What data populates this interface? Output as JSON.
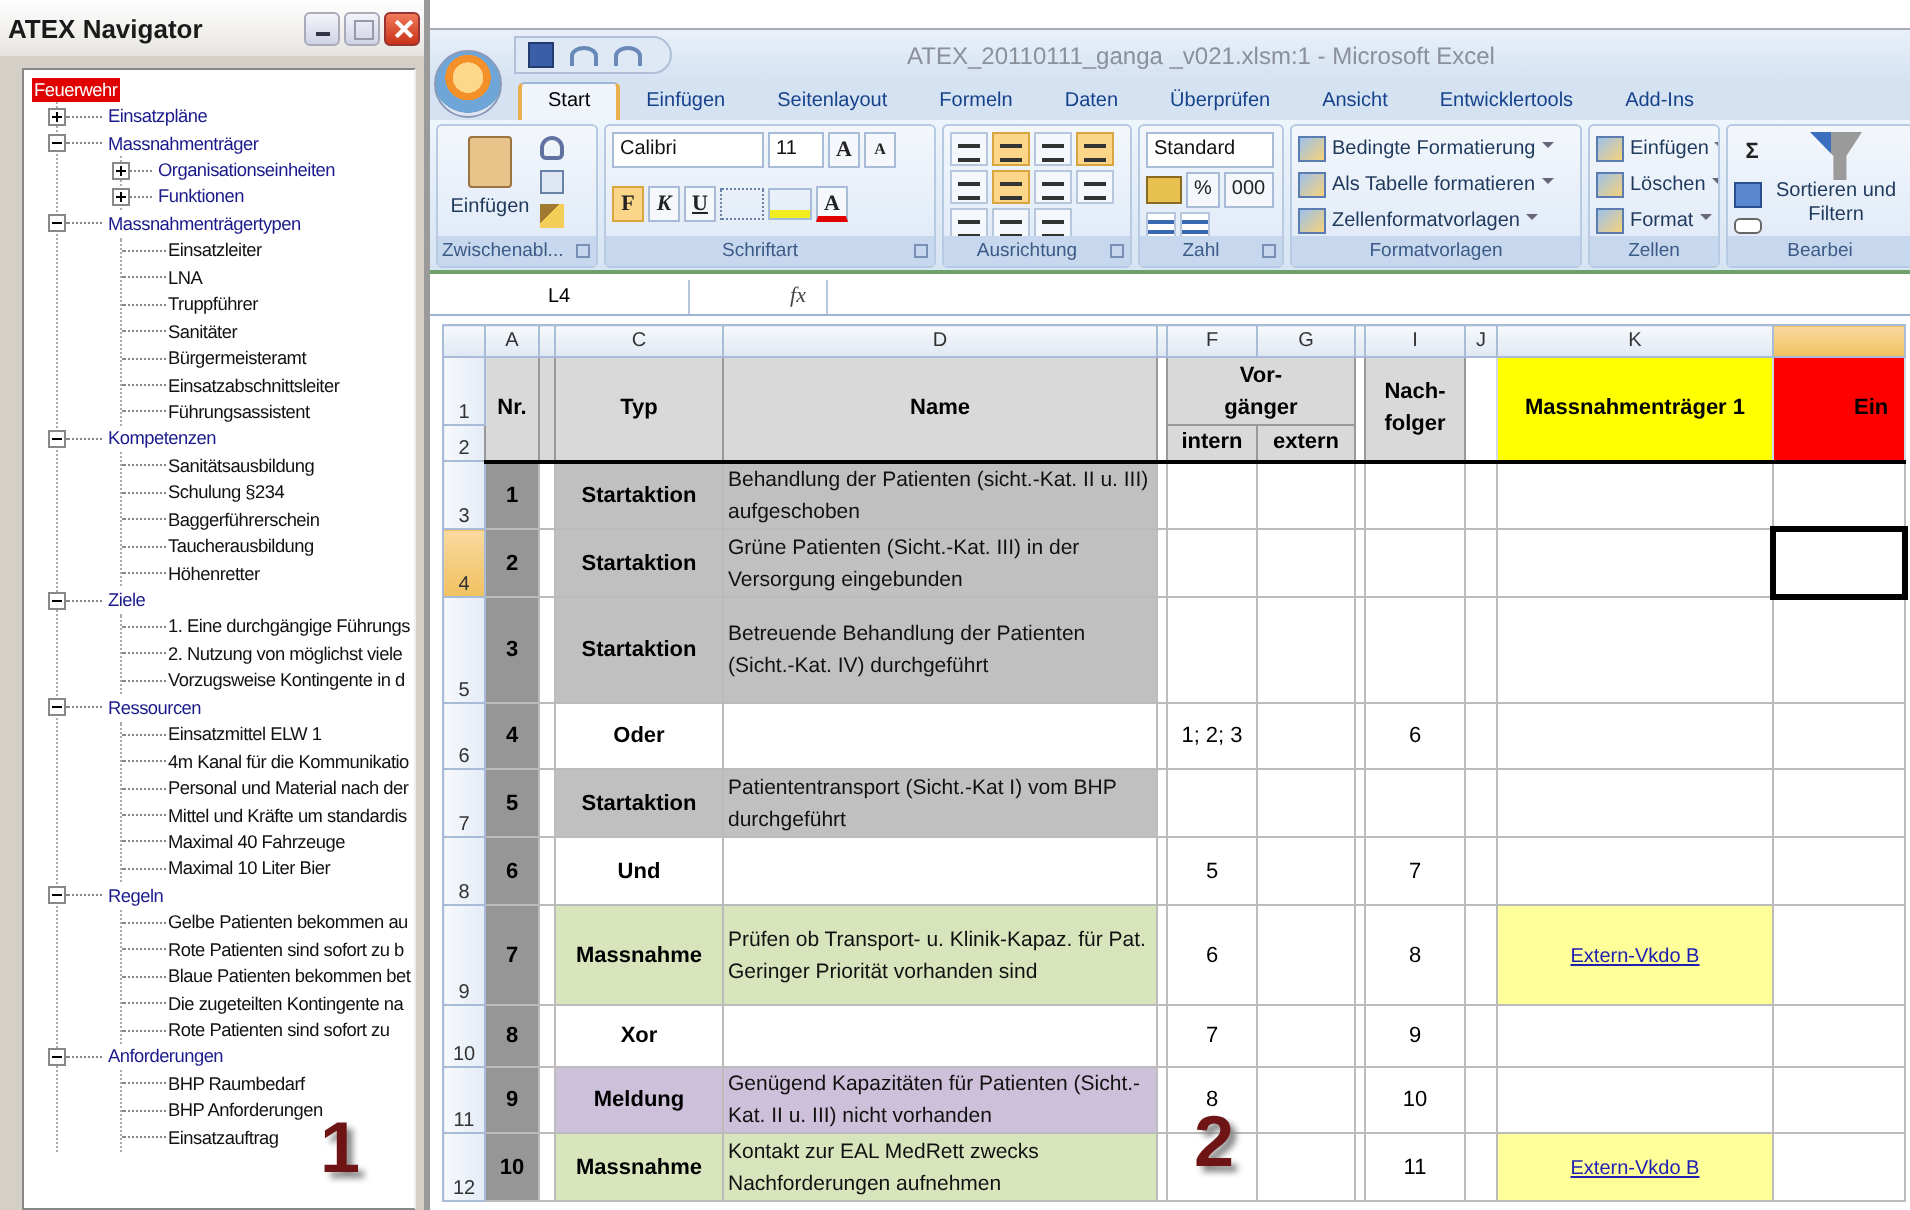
{
  "navigator": {
    "title": "ATEX Navigator",
    "tree": {
      "label": "Feuerwehr",
      "selected": true,
      "children": [
        {
          "label": "Einsatzpläne",
          "expanded": false,
          "selected": false
        },
        {
          "label": "Massnahmenträger",
          "expanded": true,
          "selected": false,
          "children": [
            {
              "label": "Organisationseinheiten",
              "expanded": false,
              "selected": false
            },
            {
              "label": "Funktionen",
              "expanded": false,
              "selected": false
            }
          ]
        },
        {
          "label": "Massnahmenträgertypen",
          "expanded": true,
          "selected": false,
          "children": [
            {
              "label": "Einsatzleiter",
              "selected": false
            },
            {
              "label": "LNA",
              "selected": false
            },
            {
              "label": "Truppführer",
              "selected": false
            },
            {
              "label": "Sanitäter",
              "selected": false
            },
            {
              "label": "Bürgermeisteramt",
              "selected": false
            },
            {
              "label": "Einsatzabschnittsleiter",
              "selected": false
            },
            {
              "label": "Führungsassistent",
              "selected": false
            }
          ]
        },
        {
          "label": "Kompetenzen",
          "expanded": true,
          "selected": false,
          "children": [
            {
              "label": "Sanitätsausbildung",
              "selected": false
            },
            {
              "label": "Schulung §234",
              "selected": false
            },
            {
              "label": "Baggerführerschein",
              "selected": false
            },
            {
              "label": "Taucherausbildung",
              "selected": false
            },
            {
              "label": "Höhenretter",
              "selected": false
            }
          ]
        },
        {
          "label": "Ziele",
          "expanded": true,
          "selected": false,
          "children": [
            {
              "label": "1. Eine durchgängige Führungs",
              "selected": false
            },
            {
              "label": "2. Nutzung von möglichst viele",
              "selected": false
            },
            {
              "label": "Vorzugsweise Kontingente in d",
              "selected": false
            }
          ]
        },
        {
          "label": "Ressourcen",
          "expanded": true,
          "selected": false,
          "children": [
            {
              "label": "Einsatzmittel ELW 1",
              "selected": false
            },
            {
              "label": "4m Kanal für die Kommunikatio",
              "selected": false
            },
            {
              "label": "Personal und Material nach der",
              "selected": false
            },
            {
              "label": "Mittel und Kräfte um standardis",
              "selected": false
            },
            {
              "label": "Maximal 40 Fahrzeuge",
              "selected": false
            },
            {
              "label": "Maximal 10 Liter Bier",
              "selected": false
            }
          ]
        },
        {
          "label": "Regeln",
          "expanded": true,
          "selected": false,
          "children": [
            {
              "label": "Gelbe Patienten bekommen au",
              "selected": false
            },
            {
              "label": "Rote Patienten sind sofort zu b",
              "selected": false
            },
            {
              "label": "Blaue Patienten bekommen bet",
              "selected": false
            },
            {
              "label": "Die zugeteilten Kontingente na",
              "selected": false
            },
            {
              "label": "Rote Patienten sind sofort zu",
              "selected": false
            }
          ]
        },
        {
          "label": "Anforderungen",
          "expanded": true,
          "selected": false,
          "children": [
            {
              "label": "BHP Raumbedarf",
              "selected": false
            },
            {
              "label": "BHP Anforderungen",
              "selected": false
            },
            {
              "label": "Einsatzauftrag",
              "selected": false
            }
          ]
        }
      ]
    }
  },
  "excel": {
    "title": "ATEX_20110111_ganga _v021.xlsm:1 - Microsoft Excel",
    "tabs": [
      {
        "label": "Start",
        "selected": true
      },
      {
        "label": "Einfügen",
        "selected": false
      },
      {
        "label": "Seitenlayout",
        "selected": false
      },
      {
        "label": "Formeln",
        "selected": false
      },
      {
        "label": "Daten",
        "selected": false
      },
      {
        "label": "Überprüfen",
        "selected": false
      },
      {
        "label": "Ansicht",
        "selected": false
      },
      {
        "label": "Entwicklertools",
        "selected": false
      },
      {
        "label": "Add-Ins",
        "selected": false
      }
    ],
    "ribbon": [
      {
        "kind": "clipboard",
        "label": "Zwischenabl...",
        "paste": "Einfügen"
      },
      {
        "kind": "font",
        "label": "Schriftart",
        "font": "Calibri",
        "size": "11",
        "grow": "A",
        "shrink": "A",
        "styles": [
          {
            "label": "F",
            "on": true
          },
          {
            "label": "K",
            "on": false
          },
          {
            "label": "U",
            "on": false
          }
        ],
        "font_color": "A"
      },
      {
        "kind": "alignment",
        "label": "Ausrichtung",
        "buttons": [
          {
            "on": false
          },
          {
            "on": true
          },
          {
            "on": false
          },
          {
            "on": true
          },
          {
            "on": false
          },
          {
            "on": true
          },
          {
            "on": false
          },
          {
            "on": false
          }
        ]
      },
      {
        "kind": "number",
        "label": "Zahl",
        "format": "Standard",
        "percent": "%",
        "thousands": "000"
      },
      {
        "kind": "styles",
        "label": "Formatvorlagen",
        "items": [
          "Bedingte Formatierung",
          "Als Tabelle formatieren",
          "Zellenformatvorlagen"
        ]
      },
      {
        "kind": "cells",
        "label": "Zellen",
        "items": [
          "Einfügen",
          "Löschen",
          "Format"
        ]
      },
      {
        "kind": "editing",
        "label": "Bearbei",
        "sum": "Σ",
        "sort": "Sortieren und Filtern"
      }
    ],
    "name_box": "L4",
    "function_button": "fx",
    "sheet": {
      "column_headers": [
        {
          "label": "A",
          "selected": false
        },
        {
          "selected": false
        },
        {
          "label": "C",
          "selected": false
        },
        {
          "label": "D",
          "selected": false
        },
        {
          "selected": false
        },
        {
          "label": "F",
          "selected": false
        },
        {
          "label": "G",
          "selected": false
        },
        {
          "selected": false
        },
        {
          "label": "I",
          "selected": false
        },
        {
          "label": "J",
          "selected": false
        },
        {
          "label": "K",
          "selected": false
        },
        {
          "selected": true
        }
      ],
      "row_numbers": [
        {
          "label": "1",
          "selected": false
        },
        {
          "label": "2",
          "selected": false
        },
        {
          "label": "3",
          "selected": false
        },
        {
          "label": "4",
          "selected": true
        },
        {
          "label": "5",
          "selected": false
        },
        {
          "label": "6",
          "selected": false
        },
        {
          "label": "7",
          "selected": false
        },
        {
          "label": "8",
          "selected": false
        },
        {
          "label": "9",
          "selected": false
        },
        {
          "label": "10",
          "selected": false
        },
        {
          "label": "11",
          "selected": false
        },
        {
          "label": "12",
          "selected": false
        }
      ],
      "header": {
        "nr": "Nr.",
        "typ": "Typ",
        "name": "Name",
        "predecessor": "Vor-gänger",
        "intern": "intern",
        "extern": "extern",
        "successor": "Nach-folger",
        "k": "Massnahmenträger 1",
        "l": "Ein"
      },
      "rows": [
        {
          "kind": "startaktion",
          "nr": "1",
          "typ": "Startaktion",
          "name": "Behandlung der Patienten (sicht.-Kat. II u. III) aufgeschoben",
          "cursor": false
        },
        {
          "kind": "startaktion",
          "nr": "2",
          "typ": "Startaktion",
          "name": "Grüne Patienten (Sicht.-Kat. III) in der Versorgung eingebunden",
          "cursor": true
        },
        {
          "kind": "startaktion",
          "nr": "3",
          "typ": "Startaktion",
          "name": "Betreuende Behandlung der Patienten (Sicht.-Kat. IV) durchgeführt",
          "cursor": false
        },
        {
          "kind": "gateway",
          "nr": "4",
          "typ": "Oder",
          "intern": "1; 2; 3",
          "successor": "6",
          "cursor": false
        },
        {
          "kind": "startaktion",
          "nr": "5",
          "typ": "Startaktion",
          "name": "Patiententransport (Sicht.-Kat I) vom BHP durchgeführt",
          "cursor": false
        },
        {
          "kind": "gateway",
          "nr": "6",
          "typ": "Und",
          "intern": "5",
          "successor": "7",
          "cursor": false
        },
        {
          "kind": "massnahme",
          "nr": "7",
          "typ": "Massnahme",
          "name": "Prüfen ob Transport- u. Klinik-Kapaz. für Pat. Geringer Priorität vorhanden sind",
          "intern": "6",
          "successor": "8",
          "k": "Extern-Vkdo B",
          "cursor": false
        },
        {
          "kind": "gateway",
          "nr": "8",
          "typ": "Xor",
          "intern": "7",
          "successor": "9",
          "cursor": false
        },
        {
          "kind": "meldung",
          "nr": "9",
          "typ": "Meldung",
          "name": "Genügend Kapazitäten für Patienten (Sicht.-Kat. II u. III) nicht vorhanden",
          "intern": "8",
          "successor": "10",
          "cursor": false
        },
        {
          "kind": "massnahme",
          "nr": "10",
          "typ": "Massnahme",
          "name": "Kontakt zur EAL MedRett zwecks Nachforderungen aufnehmen",
          "successor": "11",
          "k": "Extern-Vkdo B",
          "cursor": false
        }
      ]
    }
  },
  "annotations": [
    "1",
    "2"
  ]
}
